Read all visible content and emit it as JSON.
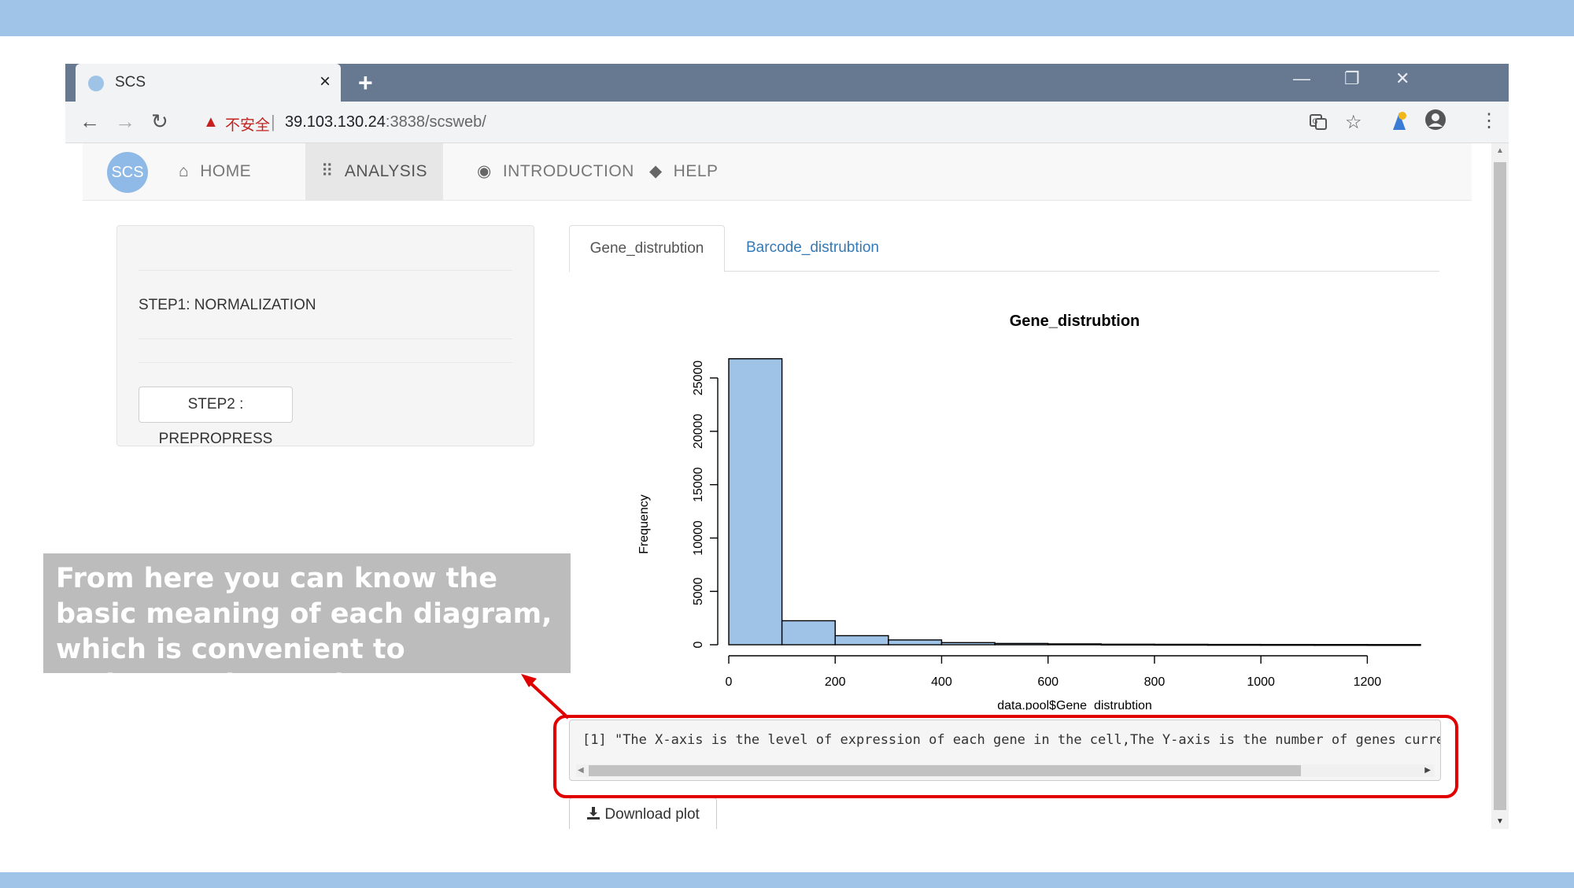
{
  "browser": {
    "tab_title": "SCS",
    "tab_close": "×",
    "new_tab": "+",
    "win_minimize": "—",
    "win_restore": "❐",
    "win_close": "✕",
    "nav_back": "←",
    "nav_forward": "→",
    "nav_reload": "↻",
    "security_icon": "▲",
    "security_text": "不安全",
    "url_host": "39.103.130.24",
    "url_rest": ":3838/scsweb/"
  },
  "navbar": {
    "logo_text": "SCS",
    "items": [
      {
        "label": "HOME",
        "icon": "home-icon",
        "glyph": "⌂"
      },
      {
        "label": "ANALYSIS",
        "icon": "bar-chart-icon",
        "glyph": "⠿"
      },
      {
        "label": "INTRODUCTION",
        "icon": "globe-icon",
        "glyph": "◉"
      },
      {
        "label": "HELP",
        "icon": "tags-icon",
        "glyph": "◆"
      }
    ],
    "active": "ANALYSIS"
  },
  "sidebar": {
    "step1_label": "STEP1: NORMALIZATION",
    "step2_button": "STEP2 : PREPROPRESS"
  },
  "tabs": {
    "items": [
      "Gene_distrubtion",
      "Barcode_distrubtion"
    ],
    "active": "Gene_distrubtion"
  },
  "chart_data": {
    "type": "bar",
    "title": "Gene_distrubtion",
    "xlabel": "data.pool$Gene_distrubtion",
    "ylabel": "Frequency",
    "bin_width": 100,
    "bins_start": [
      0,
      100,
      200,
      300,
      400,
      500,
      600,
      700,
      800,
      900,
      1000,
      1100,
      1200
    ],
    "values": [
      26800,
      2250,
      850,
      450,
      200,
      120,
      80,
      50,
      40,
      30,
      25,
      20,
      15
    ],
    "xlim": [
      0,
      1300
    ],
    "ylim": [
      0,
      27000
    ],
    "xticks": [
      "0",
      "200",
      "400",
      "600",
      "800",
      "1000",
      "1200"
    ],
    "yticks": [
      "0",
      "5000",
      "10000",
      "15000",
      "20000",
      "25000"
    ],
    "bar_color": "#9fc3e6"
  },
  "log": {
    "text": "[1] \"The X-axis is the level of expression of each gene in the cell,The Y-axis is the number of genes curre"
  },
  "download_button": "Download plot",
  "annotation": {
    "text": "From here you can know the basic meaning of each diagram, which is convenient to understand your data.",
    "highlight_color": "#e00000"
  }
}
